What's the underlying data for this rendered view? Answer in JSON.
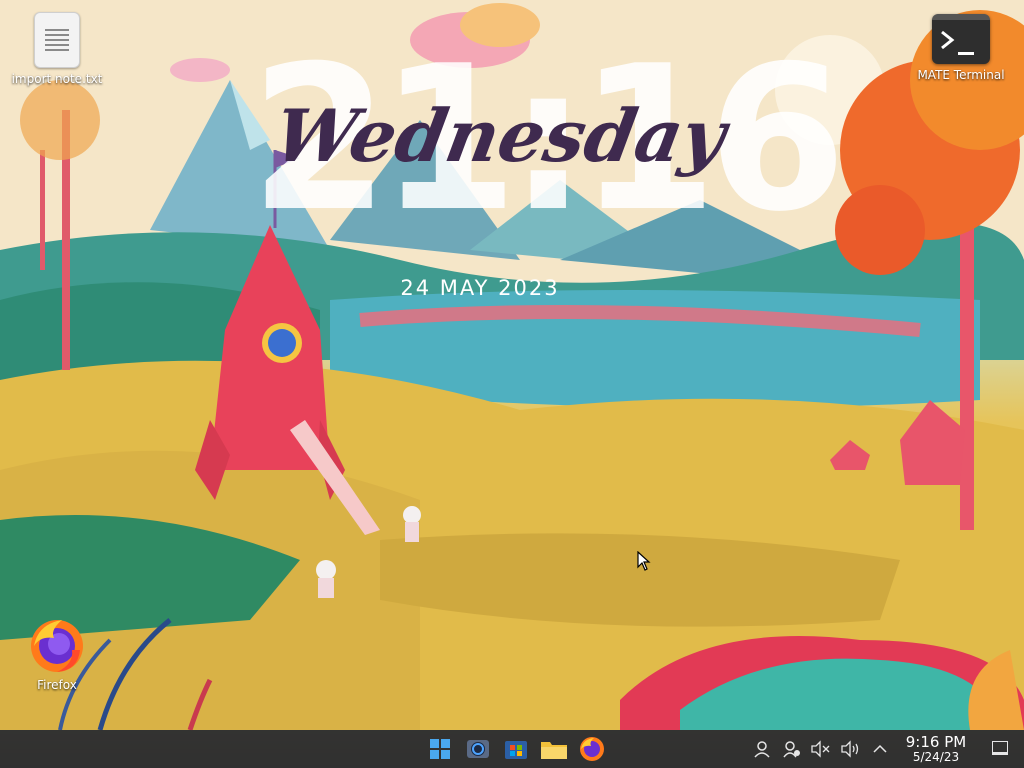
{
  "clock_widget": {
    "time": "21:16",
    "day": "Wednesday",
    "date": "24 MAY 2023"
  },
  "desktop_icons": [
    {
      "label": "import note.txt",
      "icon": "text-file-icon"
    },
    {
      "label": "MATE Terminal",
      "icon": "terminal-icon"
    },
    {
      "label": "Firefox",
      "icon": "firefox-icon"
    }
  ],
  "taskbar": {
    "apps": [
      {
        "name": "start-menu",
        "icon": "windows-start-icon"
      },
      {
        "name": "search",
        "icon": "search-circle-icon"
      },
      {
        "name": "store",
        "icon": "store-icon"
      },
      {
        "name": "file-manager",
        "icon": "folder-icon"
      },
      {
        "name": "firefox",
        "icon": "firefox-icon"
      }
    ],
    "tray": {
      "icons": [
        "user-icon",
        "network-icon",
        "mute-icon",
        "volume-icon",
        "chevron-up-icon"
      ],
      "time": "9:16 PM",
      "date": "5/24/23"
    }
  },
  "colors": {
    "accent_purple": "#3f2a4f",
    "taskbar_bg": "#303030",
    "rocket_red": "#e8425a",
    "grass_yellow": "#e4be4c"
  }
}
